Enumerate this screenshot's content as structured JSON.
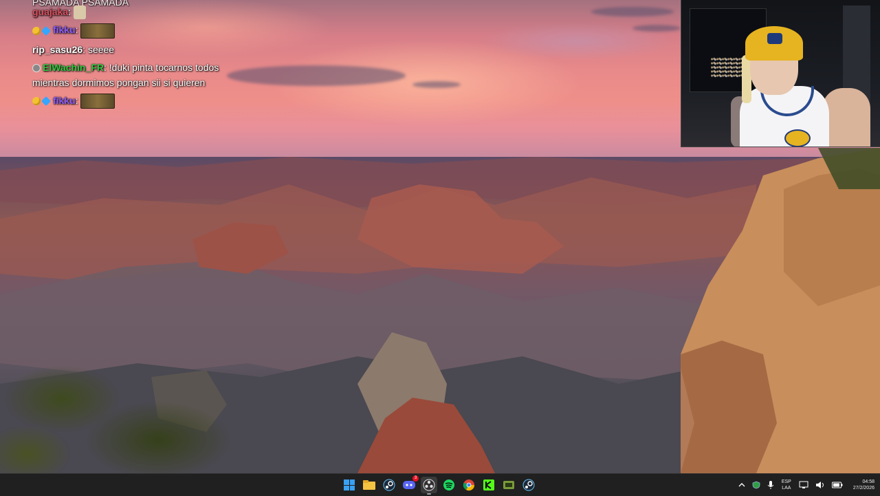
{
  "chat": {
    "messages": [
      {
        "user": "guajaka",
        "text": ""
      },
      {
        "user": "fikku",
        "text": ""
      },
      {
        "user": "rip_sasu26",
        "text": " seeee"
      },
      {
        "user": "ElWachin_FR",
        "text": " !duki pinta tocarnos todos mientras dormimos pongan sii si quieren"
      },
      {
        "user": "fikku",
        "text": ""
      }
    ],
    "partial_top": "PSAMADA  PSAMADA"
  },
  "colors": {
    "guajaka": "#d9505f",
    "fikku": "#8a5cff",
    "rip_sasu26": "#ffffff",
    "ElWachin_FR": "#2ecc40"
  },
  "taskbar": {
    "apps": [
      {
        "name": "start-icon"
      },
      {
        "name": "file-explorer-icon"
      },
      {
        "name": "steam-icon"
      },
      {
        "name": "discord-icon",
        "badge": "3"
      },
      {
        "name": "obs-icon"
      },
      {
        "name": "spotify-icon"
      },
      {
        "name": "chrome-icon"
      },
      {
        "name": "kick-icon"
      },
      {
        "name": "game-launcher-icon"
      },
      {
        "name": "steam-icon-2"
      }
    ],
    "tray": {
      "lang_top": "ESP",
      "lang_bottom": "LAA",
      "time": "04:58",
      "date": "27/2/2026"
    }
  }
}
